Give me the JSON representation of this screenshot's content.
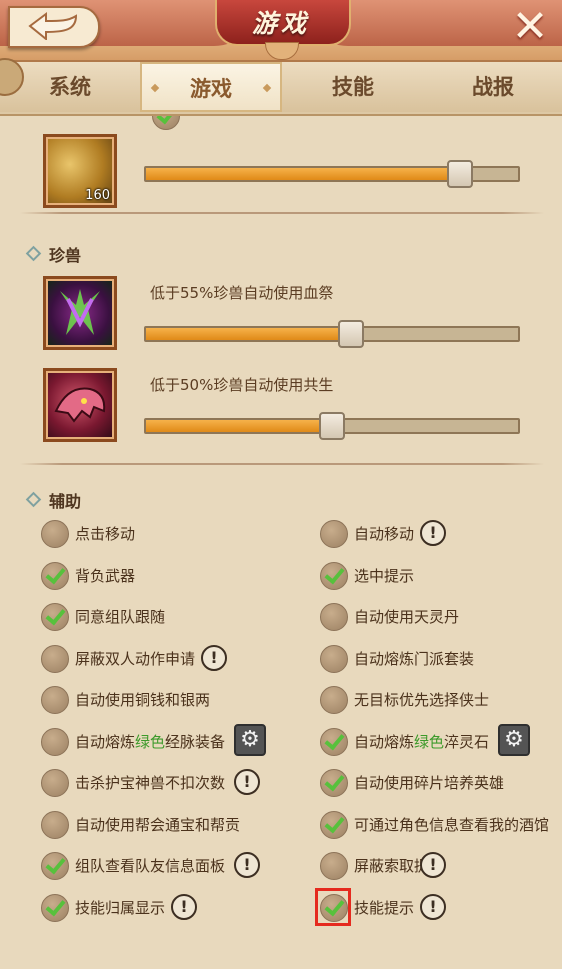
{
  "header": {
    "title": "游戏"
  },
  "tabs": [
    {
      "label": "系统",
      "active": false
    },
    {
      "label": "游戏",
      "active": true
    },
    {
      "label": "技能",
      "active": false
    },
    {
      "label": "战报",
      "active": false
    }
  ],
  "pill_section": {
    "item_quantity": "160",
    "slider_value": 0.84
  },
  "pet_section": {
    "title": "珍兽",
    "options": [
      {
        "label": "低于55%珍兽自动使用血祭",
        "slider_value": 0.55
      },
      {
        "label": "低于50%珍兽自动使用共生",
        "slider_value": 0.5
      }
    ]
  },
  "assist_section": {
    "title": "辅助",
    "accent_green": "#3c9a2a",
    "left": [
      {
        "label": "点击移动",
        "checked": false
      },
      {
        "label": "背负武器",
        "checked": true
      },
      {
        "label": "同意组队跟随",
        "checked": true
      },
      {
        "label": "屏蔽双人动作申请",
        "checked": false
      },
      {
        "label": "自动使用铜钱和银两",
        "checked": false
      },
      {
        "label_pre": "自动熔炼",
        "label_green": "绿色",
        "label_post": "经脉装备",
        "checked": false
      },
      {
        "label": "击杀护宝神兽不扣次数",
        "checked": false
      },
      {
        "label": "自动使用帮会通宝和帮贡",
        "checked": false
      },
      {
        "label": "组队查看队友信息面板",
        "checked": true
      },
      {
        "label": "技能归属显示",
        "checked": true
      }
    ],
    "right": [
      {
        "label": "自动移动",
        "checked": false
      },
      {
        "label": "选中提示",
        "checked": true
      },
      {
        "label": "自动使用天灵丹",
        "checked": false
      },
      {
        "label": "自动熔炼门派套装",
        "checked": false
      },
      {
        "label": "无目标优先选择侠士",
        "checked": false
      },
      {
        "label_pre": "自动熔炼",
        "label_green": "绿色",
        "label_post": "淬灵石",
        "checked": true
      },
      {
        "label": "自动使用碎片培养英雄",
        "checked": true
      },
      {
        "label": "可通过角色信息查看我的酒馆",
        "checked": true
      },
      {
        "label": "屏蔽索取提示",
        "checked": false
      },
      {
        "label": "技能提示",
        "checked": true
      }
    ],
    "info_glyph": "!",
    "gear_glyph": "⚙"
  }
}
